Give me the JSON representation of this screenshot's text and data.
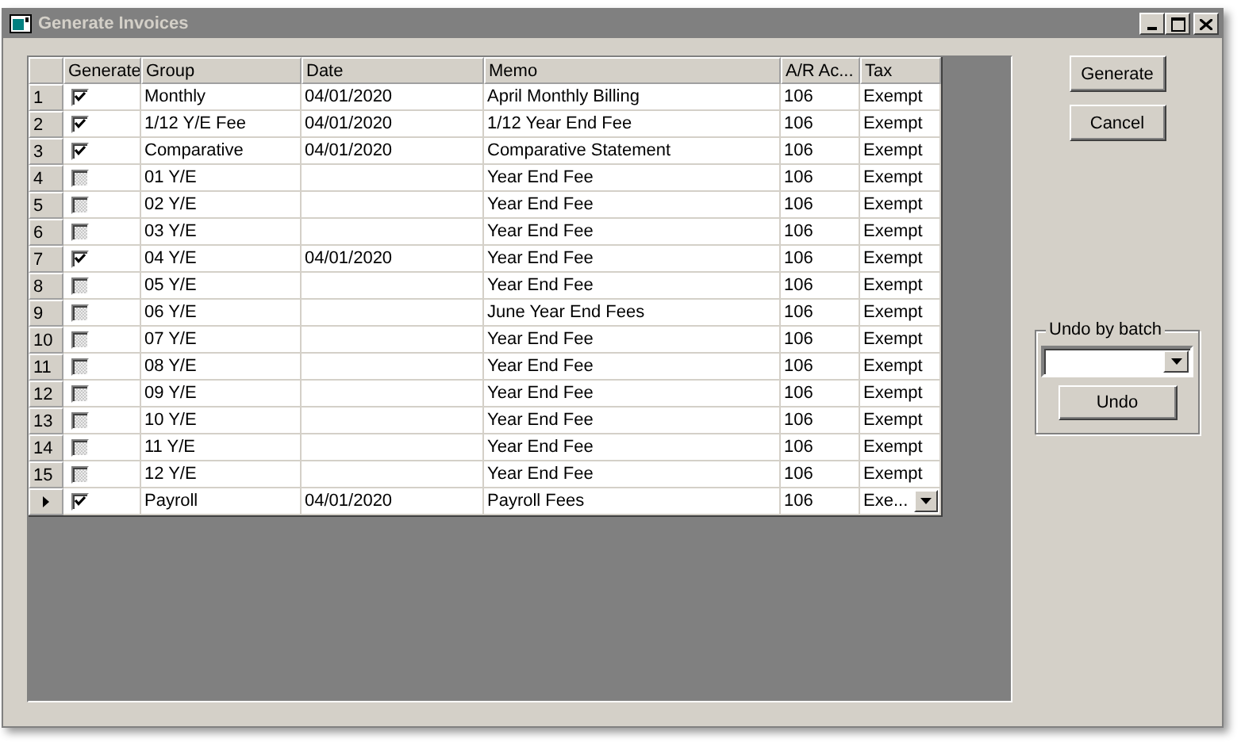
{
  "window": {
    "title": "Generate Invoices"
  },
  "table": {
    "columns": [
      "Generate",
      "Group",
      "Date",
      "Memo",
      "A/R Ac...",
      "Tax"
    ],
    "rows": [
      {
        "number": "1",
        "checked": true,
        "group": "Monthly",
        "date": "04/01/2020",
        "memo": "April Monthly Billing",
        "ar_account": "106",
        "tax": "Exempt",
        "selected": false
      },
      {
        "number": "2",
        "checked": true,
        "group": "1/12 Y/E Fee",
        "date": "04/01/2020",
        "memo": "1/12 Year End Fee",
        "ar_account": "106",
        "tax": "Exempt",
        "selected": false
      },
      {
        "number": "3",
        "checked": true,
        "group": "Comparative",
        "date": "04/01/2020",
        "memo": "Comparative Statement",
        "ar_account": "106",
        "tax": "Exempt",
        "selected": false
      },
      {
        "number": "4",
        "checked": false,
        "group": "01 Y/E",
        "memo": "Year End Fee",
        "ar_account": "106",
        "tax": "Exempt",
        "selected": false
      },
      {
        "number": "5",
        "checked": false,
        "group": "02 Y/E",
        "memo": "Year End Fee",
        "ar_account": "106",
        "tax": "Exempt",
        "selected": false
      },
      {
        "number": "6",
        "checked": false,
        "group": "03 Y/E",
        "memo": "Year End Fee",
        "ar_account": "106",
        "tax": "Exempt",
        "selected": false
      },
      {
        "number": "7",
        "checked": true,
        "group": "04 Y/E",
        "date": "04/01/2020",
        "memo": "Year End Fee",
        "ar_account": "106",
        "tax": "Exempt",
        "selected": false
      },
      {
        "number": "8",
        "checked": false,
        "group": "05 Y/E",
        "memo": "Year End Fee",
        "ar_account": "106",
        "tax": "Exempt",
        "selected": false
      },
      {
        "number": "9",
        "checked": false,
        "group": "06 Y/E",
        "memo": "June Year End Fees",
        "ar_account": "106",
        "tax": "Exempt",
        "selected": false
      },
      {
        "number": "10",
        "checked": false,
        "group": "07 Y/E",
        "memo": "Year End Fee",
        "ar_account": "106",
        "tax": "Exempt",
        "selected": false
      },
      {
        "number": "11",
        "checked": false,
        "group": "08 Y/E",
        "memo": "Year End Fee",
        "ar_account": "106",
        "tax": "Exempt",
        "selected": false
      },
      {
        "number": "12",
        "checked": false,
        "group": "09 Y/E",
        "memo": "Year End Fee",
        "ar_account": "106",
        "tax": "Exempt",
        "selected": false
      },
      {
        "number": "13",
        "checked": false,
        "group": "10 Y/E",
        "memo": "Year End Fee",
        "ar_account": "106",
        "tax": "Exempt",
        "selected": false
      },
      {
        "number": "14",
        "checked": false,
        "group": "11 Y/E",
        "memo": "Year End Fee",
        "ar_account": "106",
        "tax": "Exempt",
        "selected": false
      },
      {
        "number": "15",
        "checked": false,
        "group": "12 Y/E",
        "memo": "Year End Fee",
        "ar_account": "106",
        "tax": "Exempt",
        "selected": false
      },
      {
        "checked": true,
        "group": "Payroll",
        "date": "04/01/2020",
        "memo": "Payroll Fees",
        "ar_account": "106",
        "tax": "Exe...",
        "selected": true
      }
    ]
  },
  "buttons": [
    "Generate",
    "Cancel"
  ],
  "undo_group": {
    "title": "Undo by batch",
    "button": "Undo"
  }
}
